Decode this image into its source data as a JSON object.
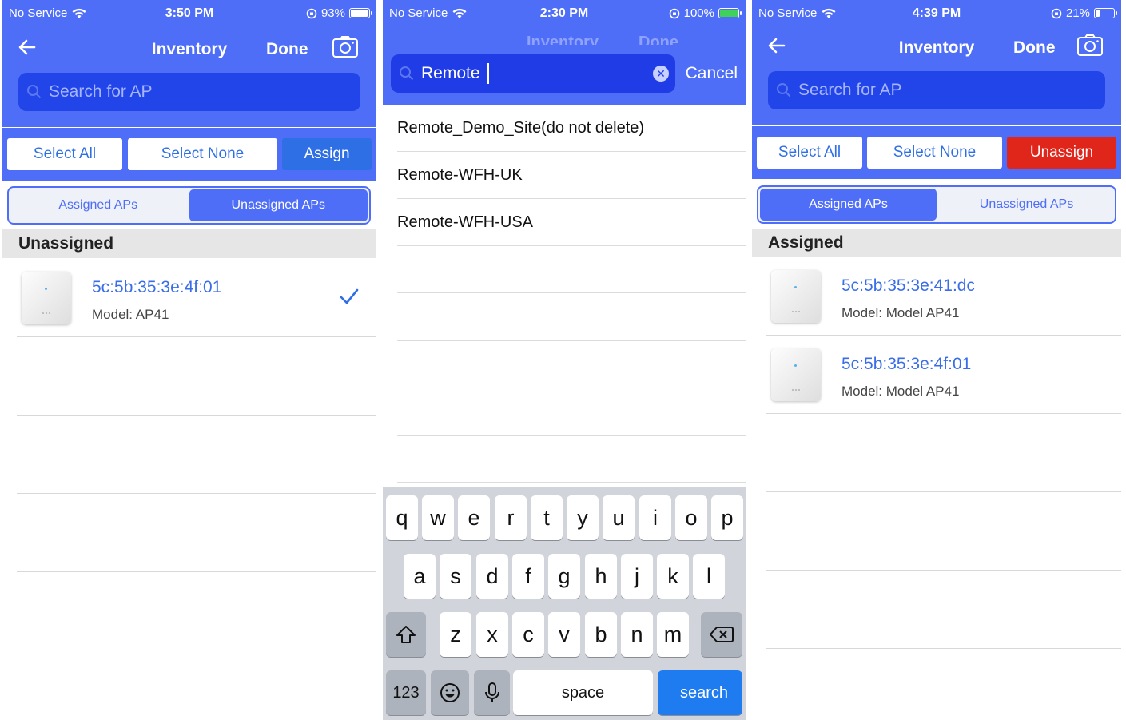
{
  "screen1": {
    "status": {
      "carrier": "No Service",
      "time": "3:50 PM",
      "battery": "93%",
      "battery_level": 0.93
    },
    "nav": {
      "title": "Inventory",
      "done": "Done"
    },
    "search_placeholder": "Search for AP",
    "toolbar": {
      "select_all": "Select All",
      "select_none": "Select None",
      "action": "Assign"
    },
    "tabs": {
      "assigned": "Assigned APs",
      "unassigned": "Unassigned APs",
      "active": "unassigned"
    },
    "section": "Unassigned",
    "items": [
      {
        "mac": "5c:5b:35:3e:4f:01",
        "model": "Model: AP41",
        "checked": true
      }
    ],
    "colors": {
      "header": "#4f6ef7",
      "link": "#3a6ee8",
      "check": "#2f6fe6"
    }
  },
  "screen2": {
    "status": {
      "carrier": "No Service",
      "time": "2:30 PM",
      "battery": "100%",
      "battery_level": 1.0
    },
    "background_nav": {
      "title": "Inventory",
      "done": "Done"
    },
    "search_value": "Remote",
    "cancel": "Cancel",
    "results": [
      "Remote_Demo_Site(do not delete)",
      "Remote-WFH-UK",
      "Remote-WFH-USA"
    ],
    "keyboard": {
      "row1": [
        "q",
        "w",
        "e",
        "r",
        "t",
        "y",
        "u",
        "i",
        "o",
        "p"
      ],
      "row2": [
        "a",
        "s",
        "d",
        "f",
        "g",
        "h",
        "j",
        "k",
        "l"
      ],
      "row3": [
        "z",
        "x",
        "c",
        "v",
        "b",
        "n",
        "m"
      ],
      "numbers": "123",
      "space": "space",
      "search": "search",
      "icons": [
        "shift-icon",
        "backspace-icon",
        "emoji-icon",
        "microphone-icon"
      ]
    }
  },
  "screen3": {
    "status": {
      "carrier": "No Service",
      "time": "4:39 PM",
      "battery": "21%",
      "battery_level": 0.21
    },
    "nav": {
      "title": "Inventory",
      "done": "Done"
    },
    "search_placeholder": "Search for AP",
    "toolbar": {
      "select_all": "Select All",
      "select_none": "Select None",
      "action": "Unassign"
    },
    "tabs": {
      "assigned": "Assigned APs",
      "unassigned": "Unassigned APs",
      "active": "assigned"
    },
    "section": "Assigned",
    "items": [
      {
        "mac": "5c:5b:35:3e:41:dc",
        "model": "Model: Model AP41"
      },
      {
        "mac": "5c:5b:35:3e:4f:01",
        "model": "Model: Model AP41"
      }
    ],
    "colors": {
      "unassign": "#e0261a"
    }
  }
}
